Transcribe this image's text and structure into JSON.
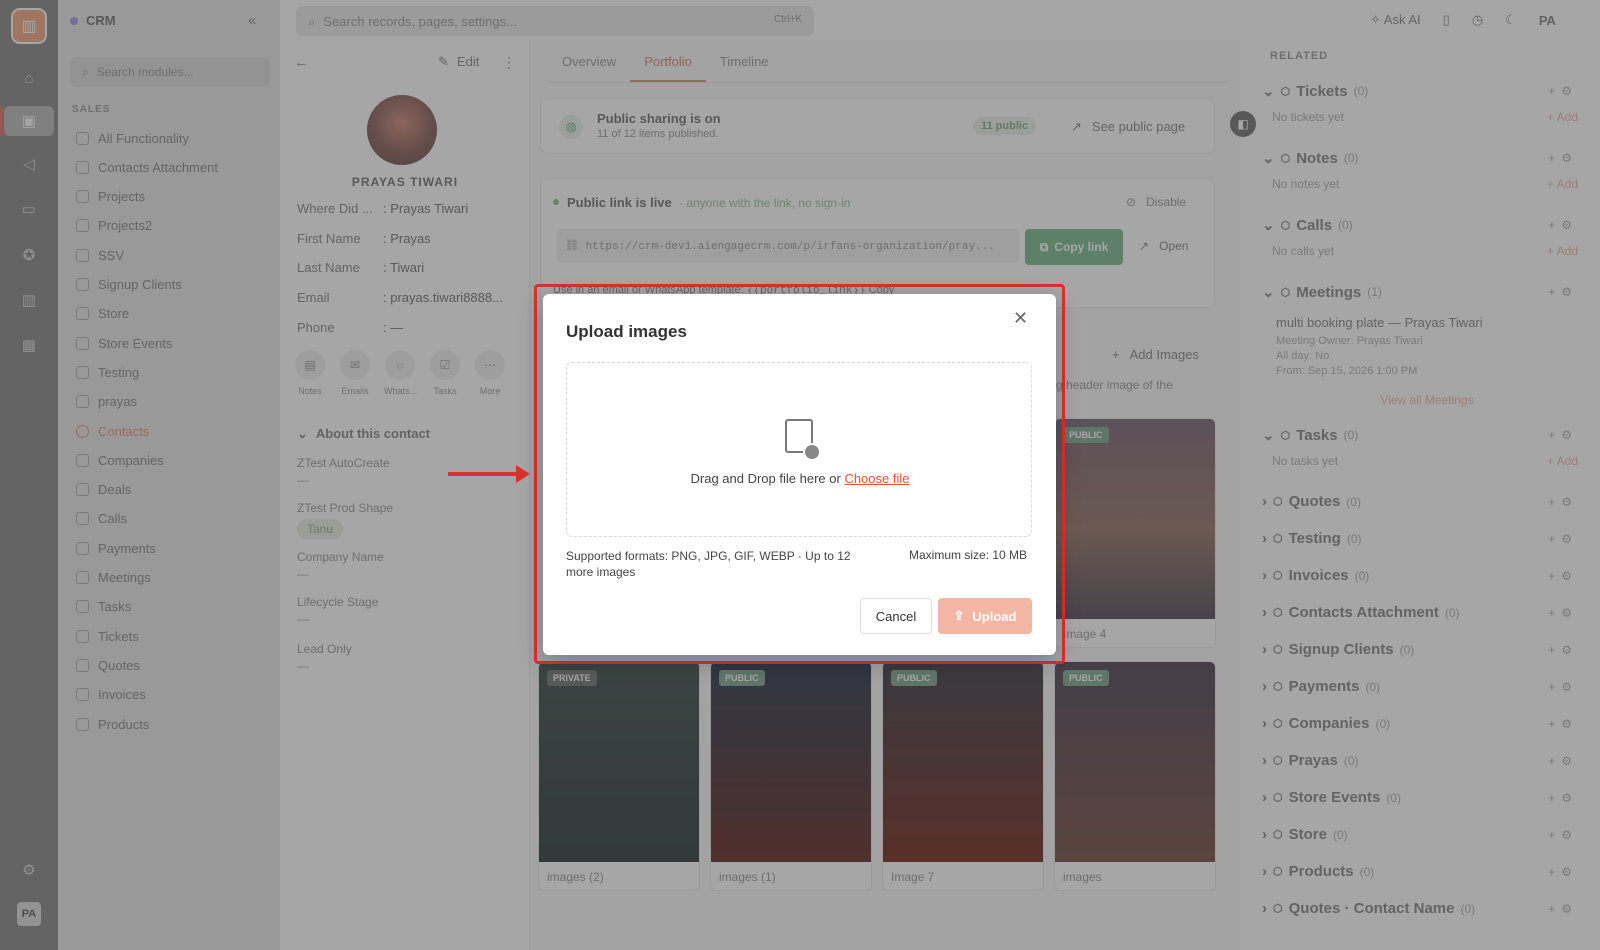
{
  "rail": {
    "avatar": "PA",
    "icons": [
      "home-icon",
      "briefcase-icon",
      "megaphone-icon",
      "inbox-icon",
      "rosette-icon",
      "chart-icon",
      "calendar-icon",
      "settings-icon"
    ]
  },
  "modules": {
    "app_name": "CRM",
    "search_placeholder": "Search modules...",
    "section": "SALES",
    "items": [
      "All Functionality",
      "Contacts Attachment",
      "Projects",
      "Projects2",
      "SSV",
      "Signup Clients",
      "Store",
      "Store Events",
      "Testing",
      "prayas",
      "Contacts",
      "Companies",
      "Deals",
      "Calls",
      "Payments",
      "Meetings",
      "Tasks",
      "Tickets",
      "Quotes",
      "Invoices",
      "Products"
    ],
    "active": "Contacts"
  },
  "topbar": {
    "search_placeholder": "Search records, pages, settings...",
    "shortcut": "Ctrl+K",
    "ask_ai": "Ask AI",
    "avatar": "PA"
  },
  "contact": {
    "edit": "Edit",
    "name": "PRAYAS TIWARI",
    "fields": [
      {
        "k": "Where Did ...",
        "v": ": Prayas Tiwari"
      },
      {
        "k": "First Name",
        "v": ": Prayas"
      },
      {
        "k": "Last Name",
        "v": ": Tiwari"
      },
      {
        "k": "Email",
        "v": ": prayas.tiwari8888..."
      },
      {
        "k": "Phone",
        "v": ": —"
      }
    ],
    "actions": [
      "Notes",
      "Emails",
      "Whats...",
      "Tasks",
      "More"
    ],
    "about_title": "About this contact",
    "about": [
      {
        "k": "ZTest AutoCreate",
        "v": "—"
      },
      {
        "k": "ZTest Prod Shape",
        "v": "Tanu"
      },
      {
        "k": "Company Name",
        "v": "—"
      },
      {
        "k": "Lifecycle Stage",
        "v": "—"
      },
      {
        "k": "Lead Only",
        "v": "—"
      }
    ]
  },
  "main": {
    "tabs": [
      "Overview",
      "Portfolio",
      "Timeline"
    ],
    "active_tab": "Portfolio",
    "sharing_title": "Public sharing is on",
    "sharing_sub": "11 of 12 items published.",
    "public_count": "11 public",
    "see_public": "See public page",
    "link_title": "Public link is live",
    "link_sub": "· anyone with the link, no sign-in",
    "disable": "Disable",
    "url": "https://crm-dev1.aiengagecrm.com/p/irfans-organization/pray...",
    "copy_link": "Copy link",
    "open": "Open",
    "template_text": "Use in an email or WhatsApp template:",
    "template_code": "{{portfolio_link}}",
    "template_copy": "Copy",
    "add_images": "Add Images",
    "header_hint": "he big header image of the",
    "photos": [
      {
        "badge": "PUBLIC",
        "caption": "Image 4"
      },
      {
        "badge": "PRIVATE",
        "caption": "images (2)"
      },
      {
        "badge": "PUBLIC",
        "caption": "images (1)"
      },
      {
        "badge": "PUBLIC",
        "caption": "Image 7"
      },
      {
        "badge": "PUBLIC",
        "caption": "images"
      }
    ]
  },
  "related": {
    "title": "RELATED",
    "add": "+ Add",
    "sections": [
      {
        "name": "Tickets",
        "count": "(0)",
        "empty": "No tickets yet"
      },
      {
        "name": "Notes",
        "count": "(0)",
        "empty": "No notes yet"
      },
      {
        "name": "Calls",
        "count": "(0)",
        "empty": "No calls yet"
      },
      {
        "name": "Meetings",
        "count": "(1)"
      },
      {
        "name": "Tasks",
        "count": "(0)",
        "empty": "No tasks yet"
      },
      {
        "name": "Quotes",
        "count": "(0)"
      },
      {
        "name": "Testing",
        "count": "(0)"
      },
      {
        "name": "Invoices",
        "count": "(0)"
      },
      {
        "name": "Contacts Attachment",
        "count": "(0)"
      },
      {
        "name": "Signup Clients",
        "count": "(0)"
      },
      {
        "name": "Payments",
        "count": "(0)"
      },
      {
        "name": "Companies",
        "count": "(0)"
      },
      {
        "name": "Prayas",
        "count": "(0)"
      },
      {
        "name": "Store Events",
        "count": "(0)"
      },
      {
        "name": "Store",
        "count": "(0)"
      },
      {
        "name": "Products",
        "count": "(0)"
      },
      {
        "name": "Quotes · Contact Name",
        "count": "(0)"
      }
    ],
    "meeting": {
      "title": "multi booking plate — Prayas Tiwari",
      "owner": "Meeting Owner: Prayas Tiwari",
      "allday": "All day: No",
      "from": "From: Sep 15, 2026 1:00 PM",
      "view_all": "View all Meetings"
    }
  },
  "modal": {
    "title": "Upload images",
    "drop_text": "Drag and Drop file here or",
    "choose": "Choose file",
    "formats": "Supported formats: PNG, JPG, GIF, WEBP · Up to 12 more images",
    "max": "Maximum size: 10 MB",
    "cancel": "Cancel",
    "upload": "Upload"
  }
}
